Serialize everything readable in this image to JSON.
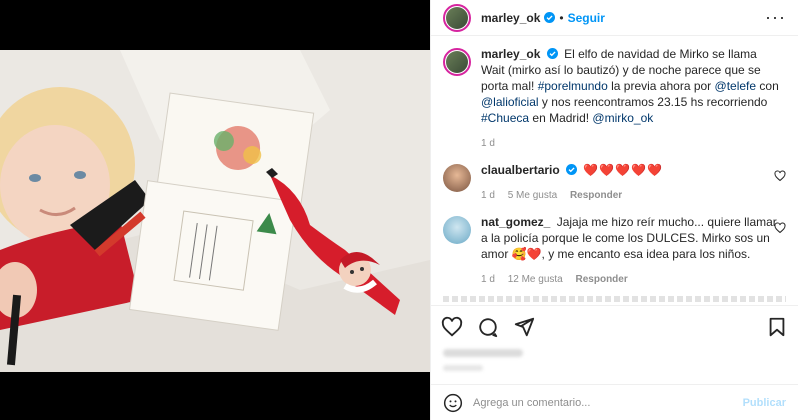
{
  "post": {
    "username": "marley_ok",
    "follow_label": "Seguir",
    "more_icon": "more-horizontal-icon"
  },
  "caption": {
    "username": "marley_ok",
    "text_1": "El elfo de navidad de Mirko se llama Wait (mirko así lo bautizó) y de noche parece que se porta mal! ",
    "hashtag_1": "#porelmundo",
    "text_2": " la previa ahora por ",
    "mention_1": "@telefe",
    "text_3": " con ",
    "mention_2": "@lalioficial",
    "text_4": " y nos reencontramos 23.15 hs recorriendo ",
    "hashtag_2": "#Chueca",
    "text_5": " en Madrid! ",
    "mention_3": "@mirko_ok",
    "time": "1 d"
  },
  "comments": [
    {
      "username": "claualbertario",
      "text": "❤️❤️❤️❤️❤️",
      "time": "1 d",
      "likes": "5 Me gusta",
      "reply": "Responder"
    },
    {
      "username": "nat_gomez_",
      "text": "Jajaja me hizo reír mucho... quiere llamar a la policía porque le come los DULCES. Mirko sos un amor 🥰❤️, y me encanto esa idea para los niños.",
      "time": "1 d",
      "likes": "12 Me gusta",
      "reply": "Responder"
    }
  ],
  "compose": {
    "placeholder": "Agrega un comentario...",
    "publish_label": "Publicar"
  },
  "colors": {
    "accent": "#0095f6",
    "heart": "#ed1a33"
  }
}
